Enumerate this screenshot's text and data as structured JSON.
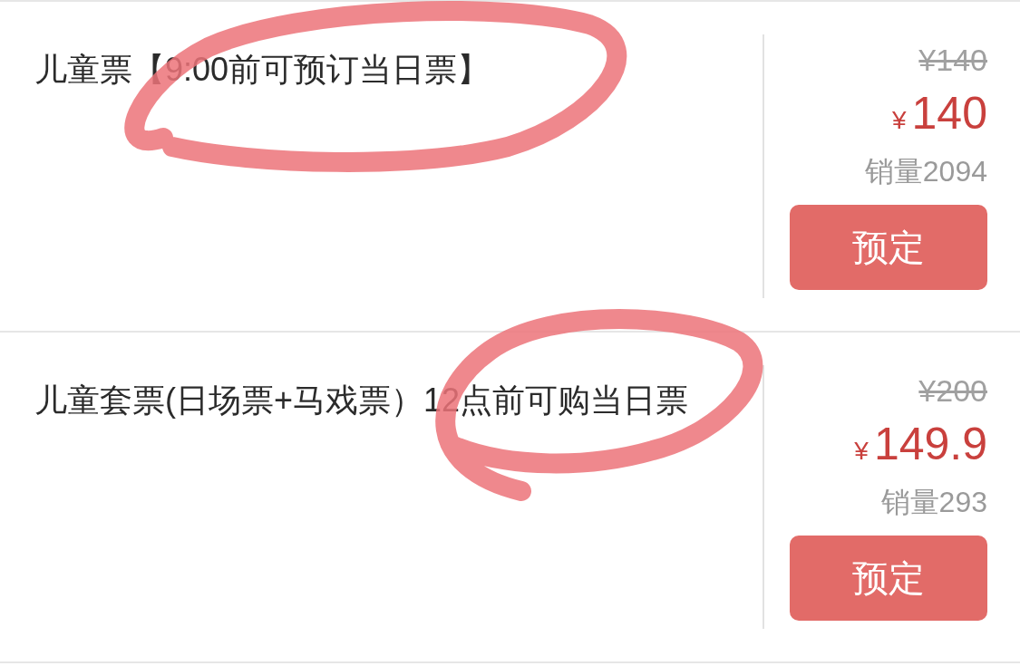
{
  "tickets": [
    {
      "title": "儿童票【9:00前可预订当日票】",
      "original_price": "¥140",
      "currency": "¥",
      "price": "140",
      "sales": "销量2094",
      "button": "预定",
      "circled": true
    },
    {
      "title": "儿童套票(日场票+马戏票）12点前可购当日票",
      "original_price": "¥200",
      "currency": "¥",
      "price": "149.9",
      "sales": "销量293",
      "button": "预定",
      "circled": true
    }
  ]
}
